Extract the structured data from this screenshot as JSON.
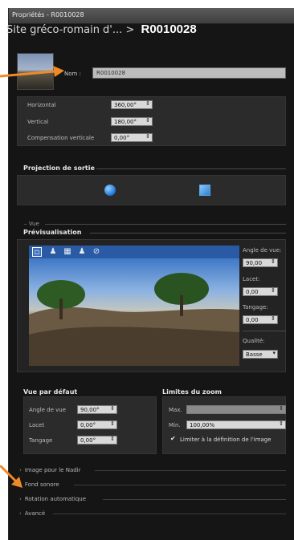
{
  "window": {
    "title": "Propriétés - R0010028"
  },
  "breadcrumb": {
    "parent": "Site gréco-romain d'...",
    "separator": ">",
    "current": "R0010028"
  },
  "name_field": {
    "label": "Nom :",
    "value": "R0010028"
  },
  "alignment": {
    "horizontal": {
      "label": "Horizontal",
      "value": "360,00°"
    },
    "vertical": {
      "label": "Vertical",
      "value": "180,00°"
    },
    "vertical_comp": {
      "label": "Compensation verticale",
      "value": "0,00°"
    }
  },
  "output_projection": {
    "heading": "Projection de sortie",
    "icons": [
      "globe-icon",
      "square-icon"
    ]
  },
  "view_section": {
    "label": "Vue"
  },
  "preview": {
    "heading": "Prévisualisation",
    "toolbar_icons": [
      "select-icon",
      "hand-icon",
      "image-icon",
      "hand-icon",
      "no-icon"
    ],
    "angle": {
      "label": "Angle de vue:",
      "value": "90,00"
    },
    "lacet": {
      "label": "Lacet:",
      "value": "0,00"
    },
    "tangage": {
      "label": "Tangage:",
      "value": "0,00"
    },
    "quality": {
      "label": "Qualité:",
      "value": "Basse"
    }
  },
  "default_view": {
    "heading": "Vue par défaut",
    "angle": {
      "label": "Angle de vue",
      "value": "90,00°"
    },
    "lacet": {
      "label": "Lacet",
      "value": "0,00°"
    },
    "tangage": {
      "label": "Tangage",
      "value": "0,00°"
    }
  },
  "zoom_limits": {
    "heading": "Limites du zoom",
    "max": {
      "label": "Max.",
      "value": ""
    },
    "min": {
      "label": "Min.",
      "value": "100,00%"
    },
    "limit_checkbox": {
      "label": "Limiter à la définition de l'image",
      "checked": true
    }
  },
  "collapsed_sections": [
    "Image pour le Nadir",
    "Fond sonore",
    "Rotation automatique",
    "Avancé"
  ],
  "colors": {
    "accent": "#2a5aa3",
    "annotation_arrow": "#f08a24"
  }
}
